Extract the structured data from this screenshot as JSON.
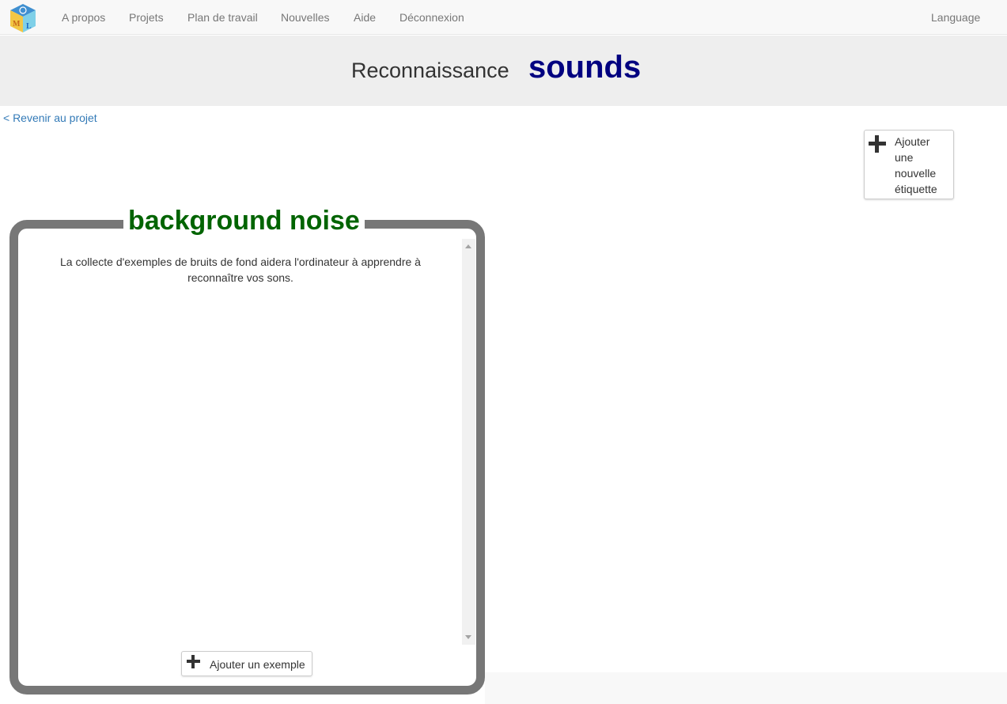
{
  "nav": {
    "logo_letters": "ML",
    "items": [
      "A propos",
      "Projets",
      "Plan de travail",
      "Nouvelles",
      "Aide",
      "Déconnexion"
    ],
    "language": "Language"
  },
  "header": {
    "subtitle": "Reconnaissance",
    "project_name": "sounds"
  },
  "back_link": "< Revenir au projet",
  "add_label_button": "Ajouter une nouvelle étiquette",
  "bucket": {
    "title": "background noise",
    "help_text": "La collecte d'exemples de bruits de fond aidera l'ordinateur à apprendre à reconnaître vos sons.",
    "add_example_label": "Ajouter un exemple"
  },
  "colors": {
    "project_name": "#000080",
    "bucket_title": "#006400",
    "bucket_border": "#777777",
    "link": "#337ab7"
  }
}
